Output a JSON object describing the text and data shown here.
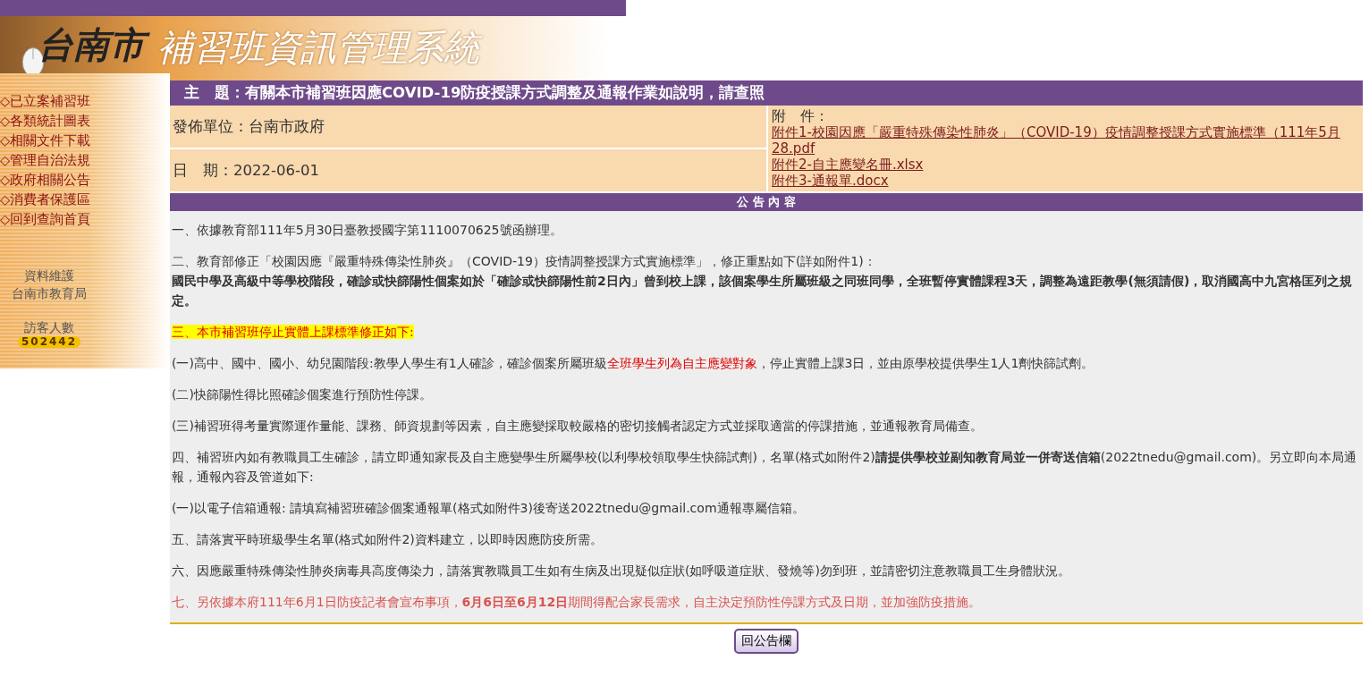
{
  "header": {
    "city": "台南市",
    "system": "補習班資訊管理系統"
  },
  "sidebar": {
    "items": [
      {
        "label": "◇已立案補習班"
      },
      {
        "label": "◇各類統計圖表"
      },
      {
        "label": "◇相關文件下載"
      },
      {
        "label": "◇管理自治法規"
      },
      {
        "label": "◇政府相關公告"
      },
      {
        "label": "◇消費者保護區"
      },
      {
        "label": "◇回到查詢首頁"
      }
    ],
    "maintainer_label": "資料維護",
    "maintainer": "台南市教育局",
    "visitor_label": "訪客人數",
    "visitor_count": "502442"
  },
  "notice": {
    "subject": "主　題：有關本市補習班因應COVID-19防疫授課方式調整及通報作業如說明，請查照",
    "issuer": "發佈單位：台南市政府",
    "date": "日　期：2022-06-01",
    "attachments_label": "附　件：",
    "attachments": [
      "附件1-校園因應「嚴重特殊傳染性肺炎」（COVID-19）疫情調整授課方式實施標準（111年5月28.pdf",
      "附件2-自主應變名冊.xlsx",
      "附件3-通報單.docx"
    ],
    "content_heading": "公 告 內 容",
    "paragraphs": [
      {
        "highlighted": false,
        "segments": [
          {
            "kind": "plain",
            "text": "一、依據教育部111年5月30日臺教授國字第1110070625號函辦理。"
          }
        ]
      },
      {
        "highlighted": false,
        "segments": [
          {
            "kind": "plain",
            "text": "二、教育部修正「校園因應『嚴重特殊傳染性肺炎』（COVID-19）疫情調整授課方式實施標準」，修正重點如下(詳如附件1)："
          },
          {
            "kind": "bold-line",
            "text": "國民中學及高級中等學校階段，確診或快篩陽性個案如於「確診或快篩陽性前2日內」曾到校上課，該個案學生所屬班級之同班同學，全班暫停實體課程3天，調整為遠距教學(無須請假)，取消國高中九宮格匡列之規定。"
          }
        ]
      },
      {
        "highlighted": true,
        "segments": [
          {
            "kind": "red",
            "text": "三、本市補習班停止實體上課標準修正如下:"
          }
        ]
      },
      {
        "highlighted": false,
        "segments": [
          {
            "kind": "plain",
            "text": "(一)高中、國中、國小、幼兒園階段:教學人學生有1人確診，確診個案所屬班級"
          },
          {
            "kind": "red",
            "text": "全班學生列為自主應變對象"
          },
          {
            "kind": "plain",
            "text": "，停止實體上課3日，並由原學校提供學生1人1劑快篩試劑。"
          }
        ]
      },
      {
        "highlighted": false,
        "segments": [
          {
            "kind": "plain",
            "text": "(二)快篩陽性得比照確診個案進行預防性停課。"
          }
        ]
      },
      {
        "highlighted": false,
        "segments": [
          {
            "kind": "plain",
            "text": "(三)補習班得考量實際運作量能、課務、師資規劃等因素，自主應變採取較嚴格的密切接觸者認定方式並採取適當的停課措施，並通報教育局備查。"
          }
        ]
      },
      {
        "highlighted": false,
        "segments": [
          {
            "kind": "plain",
            "text": "四、補習班內如有教職員工生確診，請立即通知家長及自主應變學生所屬學校(以利學校領取學生快篩試劑)，名單(格式如附件2)"
          },
          {
            "kind": "bold",
            "text": "請提供學校並副知教育局並一併寄送信箱"
          },
          {
            "kind": "plain",
            "text": "(2022tnedu@gmail.com)。另立即向本局通報，通報內容及管道如下:"
          }
        ]
      },
      {
        "highlighted": false,
        "segments": [
          {
            "kind": "plain",
            "text": "(一)以電子信箱通報: 請填寫補習班確診個案通報單(格式如附件3)後寄送2022tnedu@gmail.com通報專屬信箱。"
          }
        ]
      },
      {
        "highlighted": false,
        "segments": [
          {
            "kind": "plain",
            "text": "五、請落實平時班級學生名單(格式如附件2)資料建立，以即時因應防疫所需。"
          }
        ]
      },
      {
        "highlighted": false,
        "segments": [
          {
            "kind": "plain",
            "text": "六、因應嚴重特殊傳染性肺炎病毒具高度傳染力，請落實教職員工生如有生病及出現疑似症狀(如呼吸道症狀、發燒等)勿到班，並請密切注意教職員工生身體狀況。"
          }
        ]
      },
      {
        "highlighted": false,
        "segments": [
          {
            "kind": "soft-red",
            "text": "七、另依據本府111年6月1日防疫記者會宣布事項，"
          },
          {
            "kind": "soft-red-bold",
            "text": "6月6日至6月12日"
          },
          {
            "kind": "soft-red",
            "text": "期間得配合家長需求，自主決定預防性停課方式及日期，並加強防疫措施。"
          }
        ]
      }
    ],
    "back_button": "回公告欄"
  }
}
